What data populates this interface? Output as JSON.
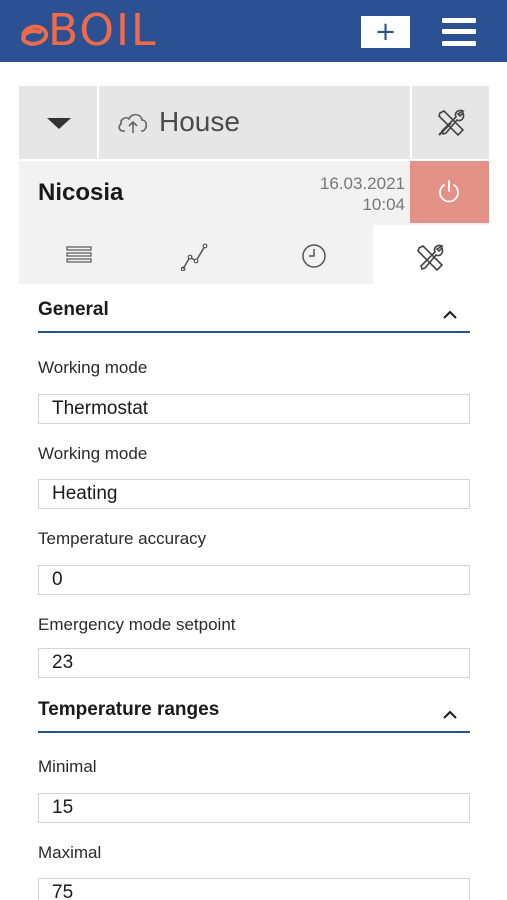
{
  "header": {
    "logo_text": "BOIL",
    "add_label": "+",
    "brand_color": "#2b5193",
    "logo_color": "#ef6a4a"
  },
  "location": {
    "name": "House",
    "dropdown_icon": "caret-down-icon",
    "cloud_icon": "cloud-upload-icon",
    "settings_icon": "tools-icon"
  },
  "device": {
    "name": "Nicosia",
    "date": "16.03.2021",
    "time": "10:04",
    "power_icon": "power-icon",
    "power_color": "#e49187"
  },
  "tabs": [
    {
      "icon": "list-icon",
      "active": false
    },
    {
      "icon": "chart-line-icon",
      "active": false
    },
    {
      "icon": "clock-icon",
      "active": false
    },
    {
      "icon": "tools-icon",
      "active": true
    }
  ],
  "sections": {
    "general": {
      "title": "General",
      "fields": [
        {
          "label": "Working mode",
          "value": "Thermostat"
        },
        {
          "label": "Working mode",
          "value": "Heating"
        },
        {
          "label": "Temperature accuracy",
          "value": "0"
        },
        {
          "label": "Emergency mode setpoint",
          "value": "23"
        }
      ]
    },
    "temperature_ranges": {
      "title": "Temperature ranges",
      "fields": [
        {
          "label": "Minimal",
          "value": "15"
        },
        {
          "label": "Maximal",
          "value": "75"
        }
      ]
    }
  }
}
